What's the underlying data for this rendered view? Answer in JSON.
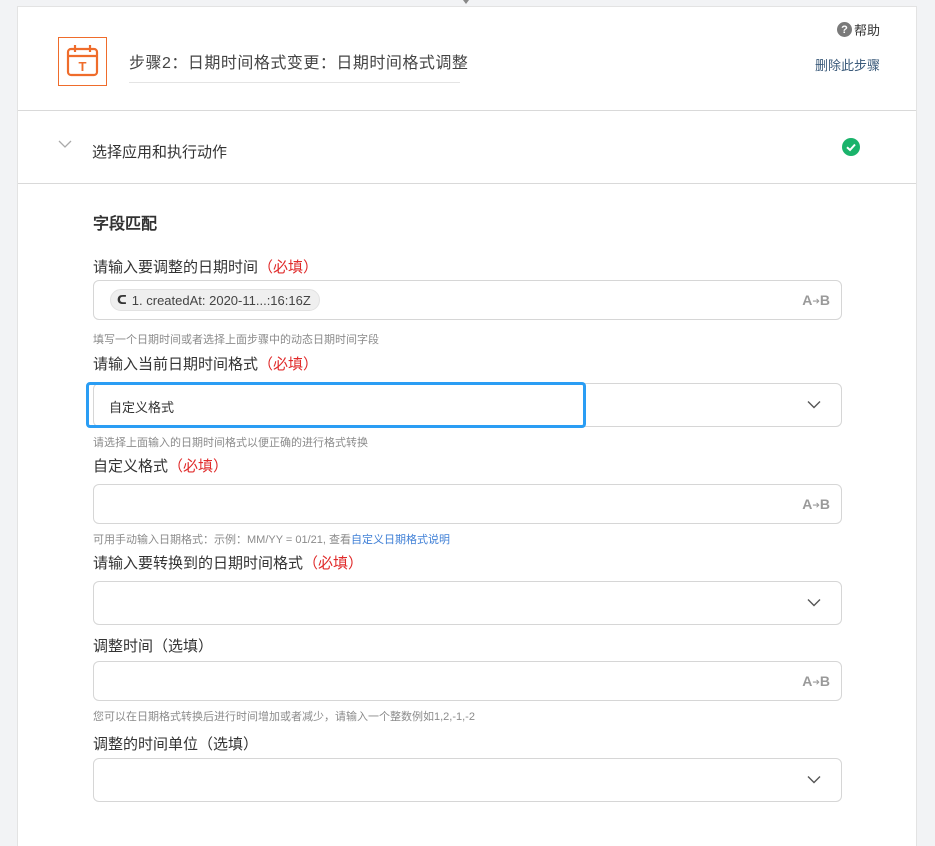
{
  "header": {
    "step_title": "步骤2：日期时间格式变更：日期时间格式调整",
    "help_label": "帮助",
    "help_icon": "question-circle-icon",
    "delete_step_label": "删除此步骤",
    "app_icon": "calendar-t-icon",
    "app_icon_glyph": "T",
    "brand_color": "#ef6c2b"
  },
  "section": {
    "title": "选择应用和执行动作",
    "status_icon": "check-circle-icon",
    "status_color": "#1ab36b"
  },
  "form": {
    "heading": "字段匹配",
    "fields": [
      {
        "label": "请输入要调整的日期时间",
        "required": "（必填）",
        "token_icon": "app-icon",
        "token_glyph": "ᑕ",
        "token_text": "1. createdAt: 2020-11...:16:16Z",
        "type_icon": "A→B",
        "hint": "填写一个日期时间或者选择上面步骤中的动态日期时间字段"
      },
      {
        "label": "请输入当前日期时间格式",
        "required": "（必填）",
        "value": "自定义格式",
        "hint": "请选择上面输入的日期时间格式以便正确的进行格式转换"
      },
      {
        "label": "自定义格式",
        "required": "（必填）",
        "type_icon": "A→B",
        "hint": "可用手动输入日期格式：示例：MM/YY = 01/21, 查看",
        "hint_link": "自定义日期格式说明"
      },
      {
        "label": "请输入要转换到的日期时间格式",
        "required": "（必填）",
        "value": ""
      },
      {
        "label": "调整时间（选填）",
        "type_icon": "A→B",
        "hint": "您可以在日期格式转换后进行时间增加或者减少，请输入一个整数例如1,2,-1,-2"
      },
      {
        "label": "调整的时间单位（选填）",
        "value": ""
      }
    ]
  },
  "focus_color": "#2a9df4"
}
